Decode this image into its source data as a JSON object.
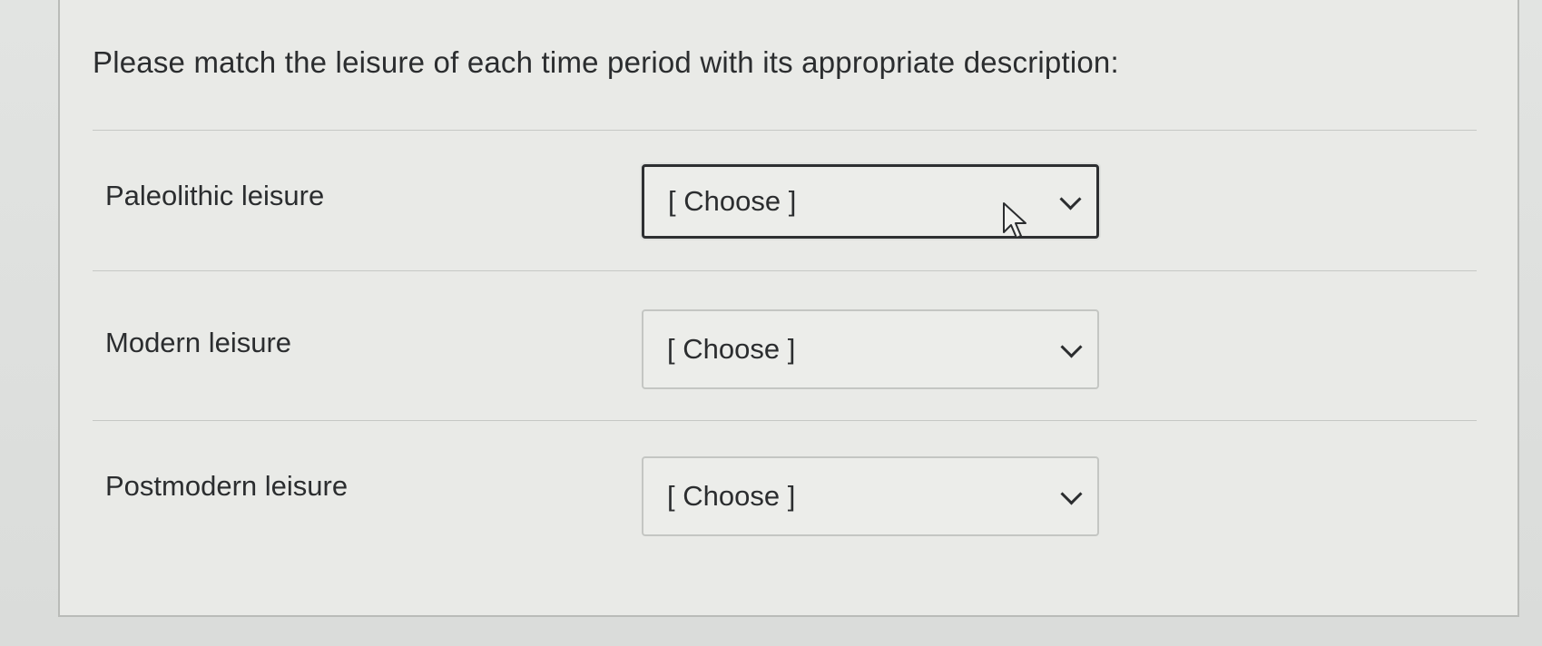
{
  "question": {
    "prompt": "Please match the leisure of each time period with its appropriate description:"
  },
  "rows": [
    {
      "label": "Paleolithic leisure",
      "selected": "[ Choose ]",
      "focused": true
    },
    {
      "label": "Modern leisure",
      "selected": "[ Choose ]",
      "focused": false
    },
    {
      "label": "Postmodern leisure",
      "selected": "[ Choose ]",
      "focused": false
    }
  ],
  "icons": {
    "dropdown": "chevron-down-icon",
    "pointer": "mouse-pointer-icon"
  }
}
